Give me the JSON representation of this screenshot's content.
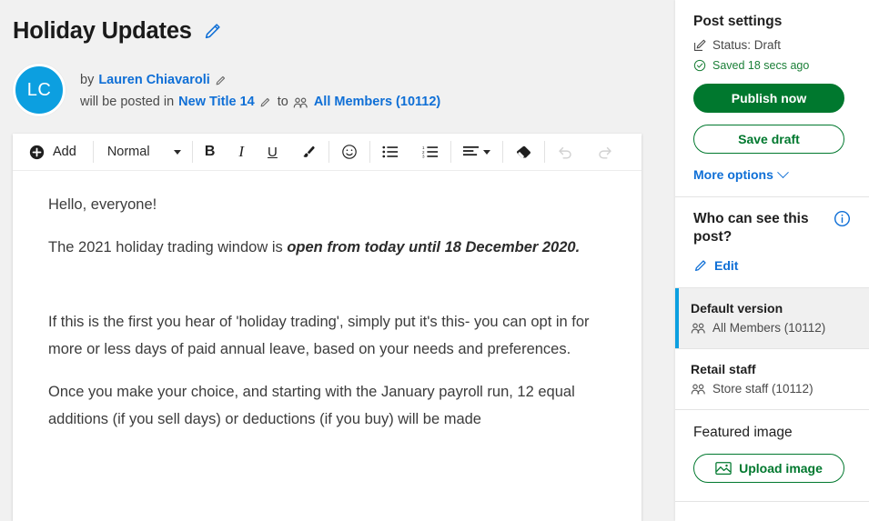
{
  "post": {
    "title": "Holiday Updates",
    "edit_title_icon": "pencil-icon",
    "author_prefix": "by",
    "author_name": "Lauren Chiavaroli",
    "posted_prefix": "will be posted in",
    "space_name": "New Title 14",
    "to_word": "to",
    "audience": "All Members (10112)",
    "avatar_initials": "LC"
  },
  "toolbar": {
    "add_label": "Add",
    "style_label": "Normal",
    "bold_label": "B",
    "italic_label": "I",
    "underline_label": "U",
    "items": [
      {
        "name": "add-button",
        "label": "Add"
      },
      {
        "name": "style-select",
        "label": "Normal"
      },
      {
        "name": "bold-button",
        "label": "B"
      },
      {
        "name": "italic-button",
        "label": "I"
      },
      {
        "name": "underline-button",
        "label": "U"
      },
      {
        "name": "text-color-button",
        "label": "brush-icon"
      },
      {
        "name": "emoji-button",
        "label": "emoji-icon"
      },
      {
        "name": "bulleted-list-button",
        "label": "bulleted-list-icon"
      },
      {
        "name": "numbered-list-button",
        "label": "numbered-list-icon"
      },
      {
        "name": "align-button",
        "label": "align-left-icon"
      },
      {
        "name": "clear-format-button",
        "label": "eraser-icon"
      },
      {
        "name": "undo-button",
        "label": "undo-icon"
      },
      {
        "name": "redo-button",
        "label": "redo-icon"
      }
    ]
  },
  "editor": {
    "paragraphs": [
      {
        "text": "Hello, everyone!",
        "bold_tail": ""
      },
      {
        "text": "The 2021 holiday trading window is ",
        "bold_tail": "open from today until 18 December 2020."
      },
      {
        "text": "If this is the first you hear of 'holiday trading', simply put it's this- you can opt in for more or less days of paid annual leave, based on your needs and preferences.",
        "bold_tail": ""
      },
      {
        "text": "Once you make your choice, and starting with the January payroll run, 12 equal additions (if you sell days) or deductions (if you buy) will be made",
        "bold_tail": ""
      }
    ]
  },
  "sidebar": {
    "post_settings": {
      "heading": "Post settings",
      "status_label": "Status: Draft",
      "saved_label": "Saved 18 secs ago",
      "publish_label": "Publish now",
      "save_draft_label": "Save draft",
      "more_options_label": "More options"
    },
    "who_can_see": {
      "heading": "Who can see this post?",
      "info_icon": "info-icon",
      "edit_label": "Edit"
    },
    "versions": [
      {
        "name": "Default version",
        "audience": "All Members (10112)",
        "selected": true
      },
      {
        "name": "Retail staff",
        "audience": "Store staff (10112)",
        "selected": false
      }
    ],
    "featured_image": {
      "heading": "Featured image",
      "upload_label": "Upload image"
    }
  },
  "colors": {
    "brand_green": "#00782e",
    "link_blue": "#0f6fd6",
    "accent_blue": "#0c9fe0",
    "saved_green": "#1a7f37",
    "page_bg": "#f1f1f1"
  }
}
